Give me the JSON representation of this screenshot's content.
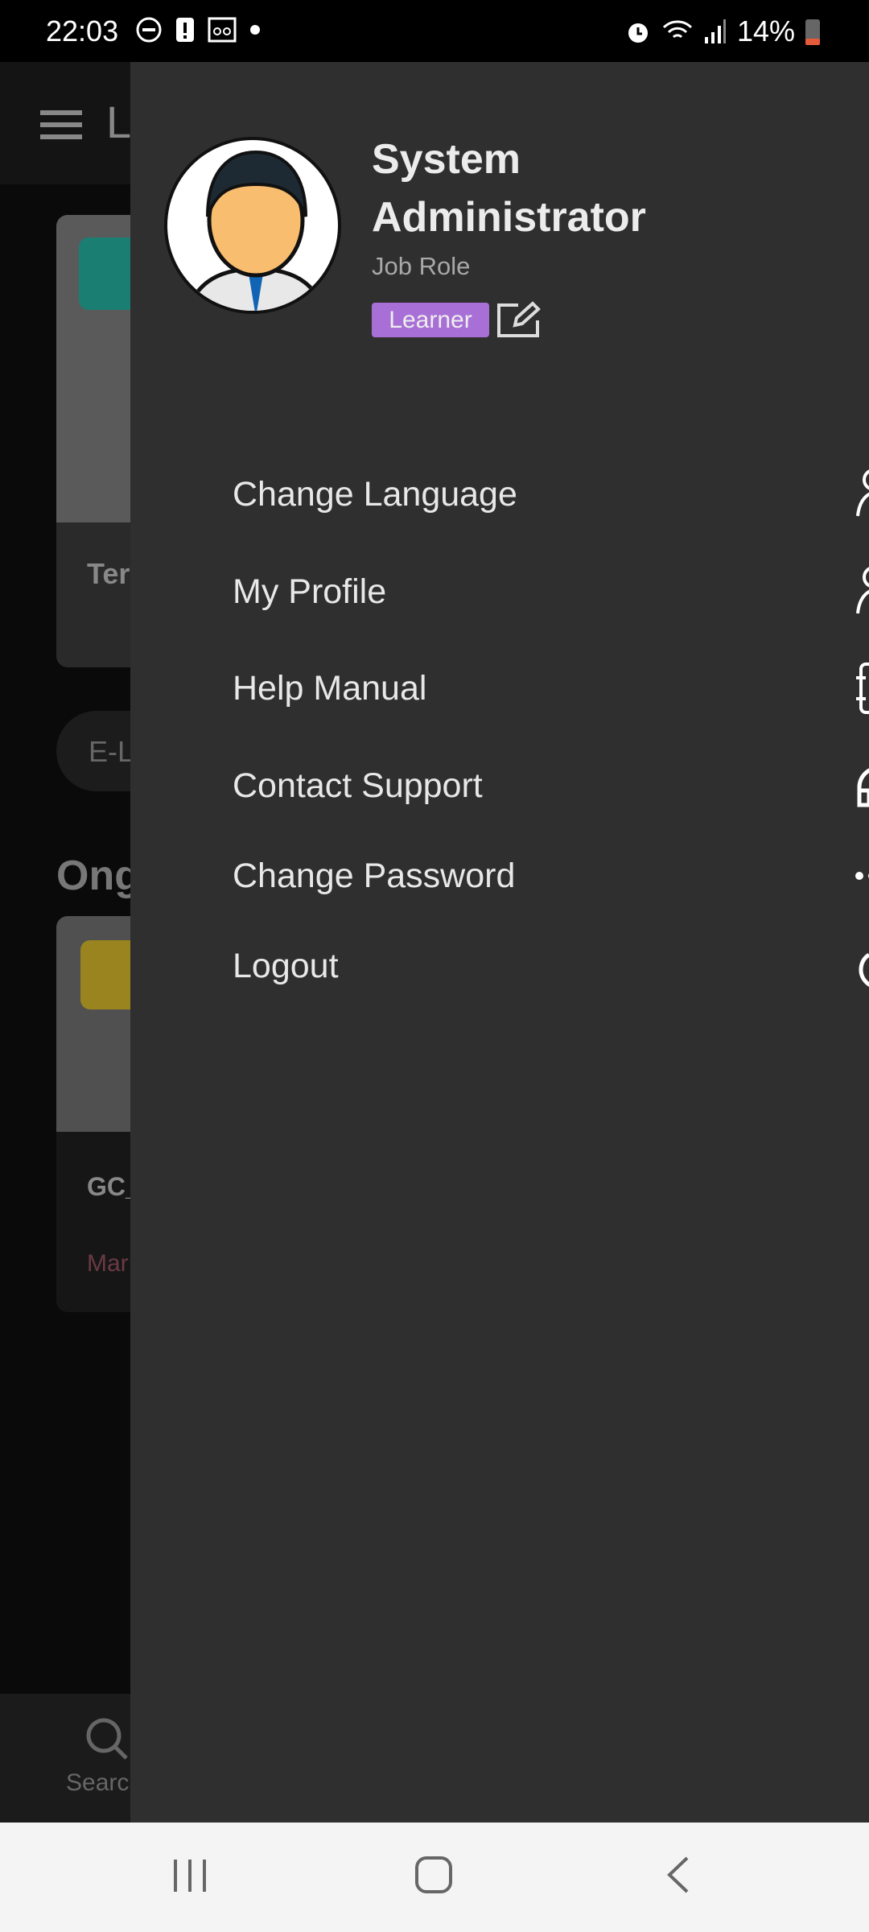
{
  "status_bar": {
    "time": "22:03",
    "battery": "14%"
  },
  "background": {
    "app_title_initial": "L",
    "card1_title": "Ter",
    "chip": "E-L",
    "section": "Ong",
    "card2_title": "GC_",
    "card2_sub": "Mar",
    "bottom_tab": "Searc"
  },
  "drawer": {
    "user_name": "System Administrator",
    "job_role": "Job Role",
    "role_badge": "Learner",
    "menu": [
      {
        "label": "Change Language",
        "icon": "user-more-icon"
      },
      {
        "label": "My Profile",
        "icon": "user-more-icon"
      },
      {
        "label": "Help Manual",
        "icon": "notebook-icon"
      },
      {
        "label": "Contact Support",
        "icon": "headphones-icon"
      },
      {
        "label": "Change Password",
        "icon": "password-icon"
      },
      {
        "label": "Logout",
        "icon": "power-icon"
      }
    ]
  },
  "colors": {
    "drawer_bg": "#2f2f2f",
    "badge": "#a86fd6"
  }
}
